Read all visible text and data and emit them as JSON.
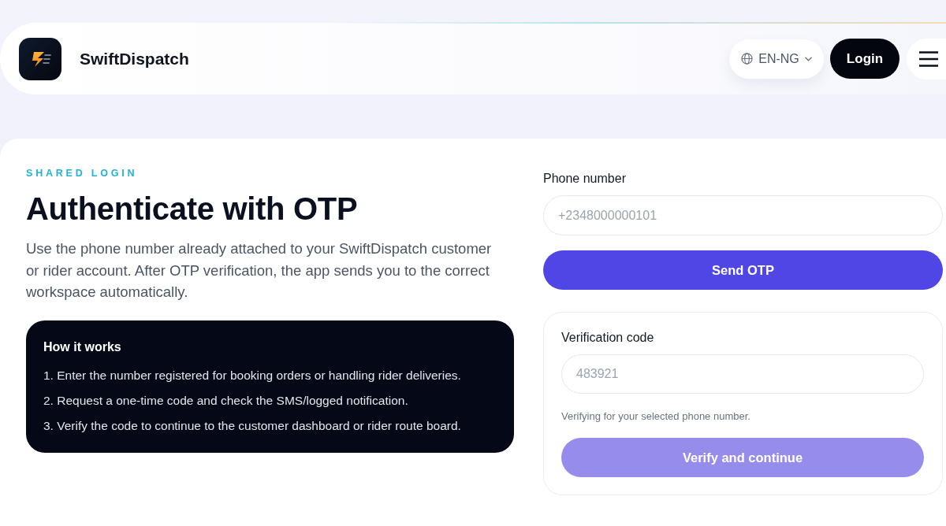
{
  "header": {
    "brand": {
      "name": "SwiftDispatch"
    },
    "language": {
      "label": "EN-NG"
    },
    "login_button": {
      "label": "Login"
    }
  },
  "intro": {
    "eyebrow": "SHARED LOGIN",
    "title": "Authenticate with OTP",
    "description": "Use the phone number already attached to your SwiftDispatch customer or rider account. After OTP verification, the app sends you to the correct workspace automatically.",
    "how_it_works": {
      "title": "How it works",
      "steps": [
        "1. Enter the number registered for booking orders or handling rider deliveries.",
        "2. Request a one-time code and check the SMS/logged notification.",
        "3. Verify the code to continue to the customer dashboard or rider route board."
      ]
    }
  },
  "phone_form": {
    "label": "Phone number",
    "placeholder": "+2348000000101",
    "button": {
      "label": "Send OTP",
      "disabled": false
    }
  },
  "verification": {
    "label": "Verification code",
    "placeholder": "483921",
    "hint": "Verifying for your selected phone number.",
    "button": {
      "label": "Verify and continue",
      "disabled": true
    }
  }
}
